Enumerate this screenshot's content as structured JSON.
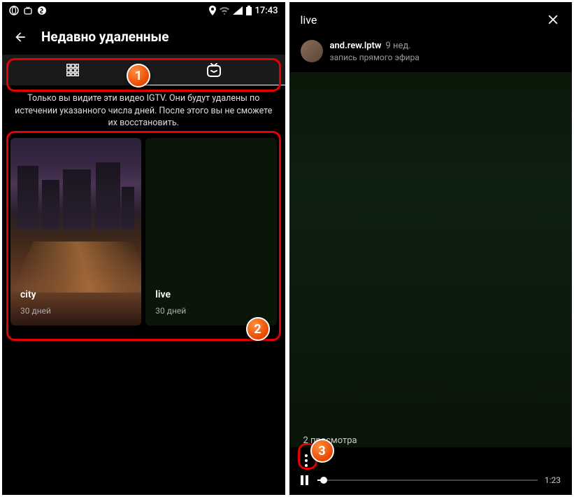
{
  "statusbar": {
    "time": "17:43"
  },
  "left": {
    "headerTitle": "Недавно удаленные",
    "infoText": "Только вы видите эти видео IGTV. Они будут удалены по истечении указанного числа дней. После этого вы не сможете их восстановить.",
    "cards": [
      {
        "title": "city",
        "days": "30 дней"
      },
      {
        "title": "live",
        "days": "30 дней"
      }
    ]
  },
  "right": {
    "title": "live",
    "username": "and.rew.lptw",
    "weeks": "9 нед.",
    "subtitle": "запись прямого эфира",
    "viewsText": "2 просмотра",
    "duration": "1:23"
  },
  "badges": {
    "b1": "1",
    "b2": "2",
    "b3": "3"
  }
}
